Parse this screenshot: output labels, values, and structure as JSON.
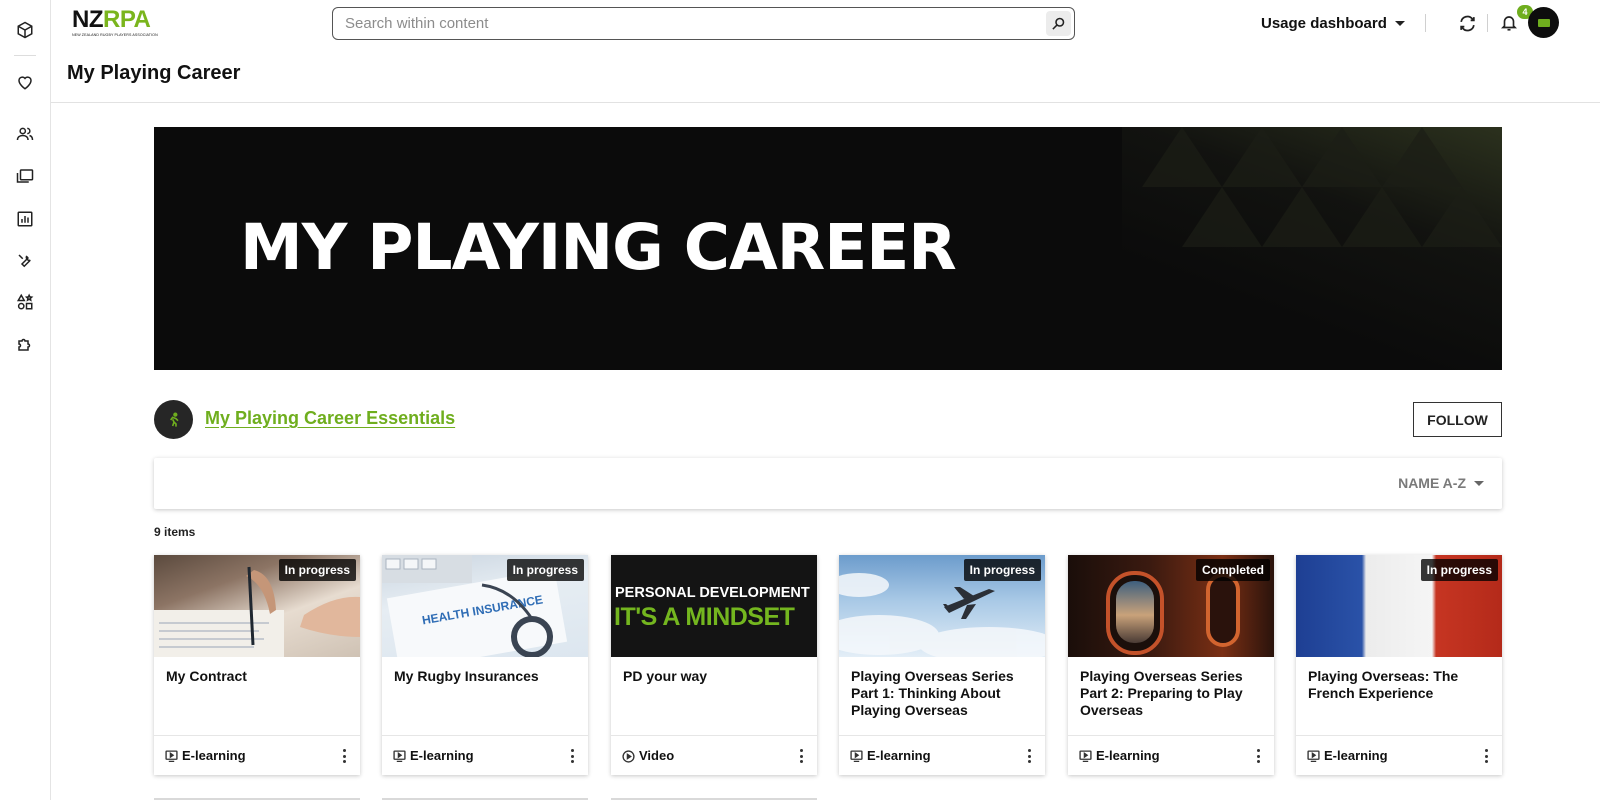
{
  "rail": {
    "items": [
      {
        "name": "cube-icon"
      },
      {
        "name": "heart-icon"
      },
      {
        "name": "users-icon"
      },
      {
        "name": "folders-icon"
      },
      {
        "name": "bar-chart-icon"
      },
      {
        "name": "wrench-icon"
      },
      {
        "name": "shapes-icon"
      },
      {
        "name": "puzzle-icon"
      }
    ]
  },
  "header": {
    "logo_main": "NZ",
    "logo_accent": "RPA",
    "logo_tagline": "NEW ZEALAND RUGBY PLAYERS ASSOCIATION",
    "search_placeholder": "Search within content",
    "dashboard_label": "Usage dashboard",
    "notification_count": "4",
    "accent_color": "#6fae1e"
  },
  "page": {
    "title": "My Playing Career",
    "banner_title": "MY PLAYING CAREER"
  },
  "section": {
    "title": "My Playing Career Essentials",
    "follow_label": "FOLLOW",
    "sort_label": "NAME A-Z",
    "item_count": "9 items"
  },
  "cards": [
    {
      "title": "My Contract",
      "status": "In progress",
      "type": "E-learning",
      "type_icon": "elearning-icon",
      "thumb": "contract"
    },
    {
      "title": "My Rugby Insurances",
      "status": "In progress",
      "type": "E-learning",
      "type_icon": "elearning-icon",
      "thumb": "insurance",
      "thumb_text": "HEALTH INSURANCE"
    },
    {
      "title": "PD your way",
      "status": "",
      "type": "Video",
      "type_icon": "video-icon",
      "thumb": "pd",
      "thumb_line1": "PERSONAL DEVELOPMENT",
      "thumb_line2": "IT'S A MINDSET"
    },
    {
      "title": "Playing Overseas Series Part 1: Thinking About Playing Overseas",
      "status": "In progress",
      "type": "E-learning",
      "type_icon": "elearning-icon",
      "thumb": "plane"
    },
    {
      "title": "Playing Overseas Series Part 2: Preparing to Play Overseas",
      "status": "Completed",
      "type": "E-learning",
      "type_icon": "elearning-icon",
      "thumb": "window"
    },
    {
      "title": "Playing Overseas: The French Experience",
      "status": "In progress",
      "type": "E-learning",
      "type_icon": "elearning-icon",
      "thumb": "france"
    }
  ]
}
